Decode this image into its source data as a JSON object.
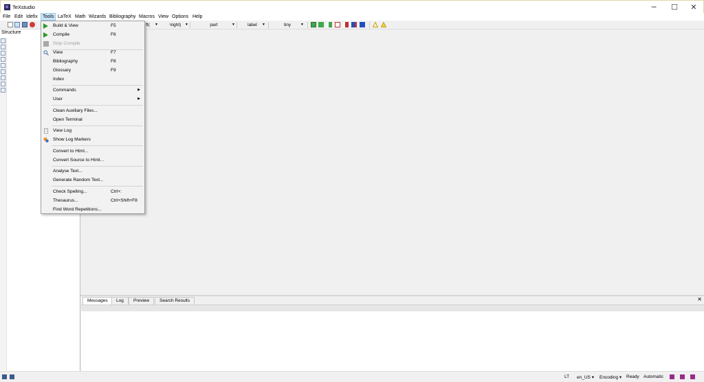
{
  "window": {
    "title": "TeXstudio",
    "controls": {
      "minimize": "─",
      "maximize": "☐",
      "close": "✕"
    }
  },
  "menubar": [
    "File",
    "Edit",
    "Idefix",
    "Tools",
    "LaTeX",
    "Math",
    "Wizards",
    "Bibliography",
    "Macros",
    "View",
    "Options",
    "Help"
  ],
  "active_menu": "Tools",
  "toolbar": {
    "combos": [
      {
        "label": "ft(",
        "arrow": "▼"
      },
      {
        "label": "\\right)",
        "arrow": "▼"
      },
      {
        "label": "part",
        "arrow": "▼"
      },
      {
        "label": "label",
        "arrow": "▼"
      },
      {
        "label": "tiny",
        "arrow": "▼"
      }
    ],
    "warning_icon_colors": [
      "#e0a800",
      "#d4b000"
    ]
  },
  "structure_panel": {
    "label": "Structure"
  },
  "tools_menu": {
    "build_view": {
      "label": "Build & View",
      "shortcut": "F5"
    },
    "compile": {
      "label": "Compile",
      "shortcut": "F6"
    },
    "stop_compile": {
      "label": "Stop Compile"
    },
    "view": {
      "label": "View",
      "shortcut": "F7"
    },
    "bibliography": {
      "label": "Bibliography",
      "shortcut": "F8"
    },
    "glossary": {
      "label": "Glossary",
      "shortcut": "F9"
    },
    "index": {
      "label": "Index"
    },
    "commands": {
      "label": "Commands",
      "arrow": "▶"
    },
    "user": {
      "label": "User",
      "arrow": "▶"
    },
    "clean_aux": {
      "label": "Clean Auxiliary Files..."
    },
    "open_terminal": {
      "label": "Open Terminal"
    },
    "view_log": {
      "label": "View Log"
    },
    "show_log_markers": {
      "label": "Show Log Markers"
    },
    "convert_html": {
      "label": "Convert to Html..."
    },
    "convert_source_html": {
      "label": "Convert Source to Html..."
    },
    "analyse_text": {
      "label": "Analyse Text..."
    },
    "generate_random": {
      "label": "Generate Random Text..."
    },
    "check_spelling": {
      "label": "Check Spelling...",
      "shortcut": "Ctrl+:"
    },
    "thesaurus": {
      "label": "Thesaurus...",
      "shortcut": "Ctrl+Shift+F8"
    },
    "find_word_rep": {
      "label": "Find Word Repetitions..."
    }
  },
  "bottom_panel": {
    "tabs": [
      "Messages",
      "Log",
      "Preview",
      "Search Results"
    ],
    "active_tab": "Messages",
    "close": "✕"
  },
  "statusbar": {
    "language": "en_US",
    "encoding": "Encoding",
    "status": "Ready",
    "mode": "Automatic",
    "lt_label": "LT",
    "dropdown_arrow": "▾"
  },
  "colors": {
    "menu_highlight": "#cce4f7",
    "compile_green": "#2a9a2a",
    "status_icon_purple": "#9a2a8a"
  }
}
